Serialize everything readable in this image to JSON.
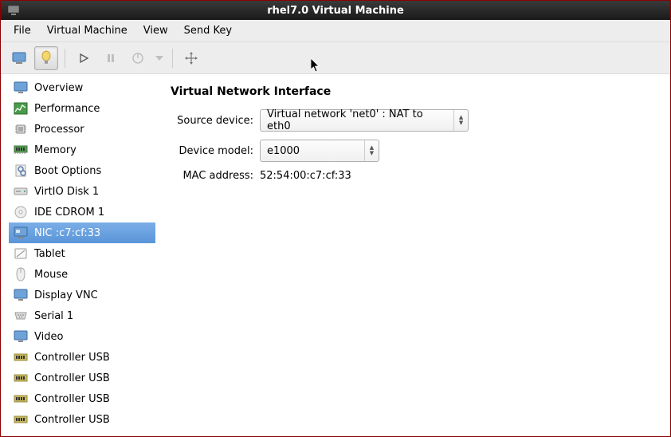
{
  "titlebar": {
    "title": "rhel7.0 Virtual Machine"
  },
  "menubar": {
    "items": [
      "File",
      "Virtual Machine",
      "View",
      "Send Key"
    ]
  },
  "sidebar": {
    "items": [
      {
        "label": "Overview",
        "icon": "monitor"
      },
      {
        "label": "Performance",
        "icon": "perf"
      },
      {
        "label": "Processor",
        "icon": "cpu"
      },
      {
        "label": "Memory",
        "icon": "mem"
      },
      {
        "label": "Boot Options",
        "icon": "boot"
      },
      {
        "label": "VirtIO Disk 1",
        "icon": "disk"
      },
      {
        "label": "IDE CDROM 1",
        "icon": "cdrom"
      },
      {
        "label": "NIC :c7:cf:33",
        "icon": "nic",
        "selected": true
      },
      {
        "label": "Tablet",
        "icon": "tablet"
      },
      {
        "label": "Mouse",
        "icon": "mouse"
      },
      {
        "label": "Display VNC",
        "icon": "display"
      },
      {
        "label": "Serial 1",
        "icon": "serial"
      },
      {
        "label": "Video",
        "icon": "video"
      },
      {
        "label": "Controller USB",
        "icon": "usb"
      },
      {
        "label": "Controller USB",
        "icon": "usb"
      },
      {
        "label": "Controller USB",
        "icon": "usb"
      },
      {
        "label": "Controller USB",
        "icon": "usb"
      }
    ]
  },
  "panel": {
    "title": "Virtual Network Interface",
    "rows": [
      {
        "label": "Source device:",
        "type": "select",
        "value": "Virtual network 'net0' : NAT to eth0"
      },
      {
        "label": "Device model:",
        "type": "select",
        "value": "e1000"
      },
      {
        "label": "MAC address:",
        "type": "text",
        "value": "52:54:00:c7:cf:33"
      }
    ]
  }
}
